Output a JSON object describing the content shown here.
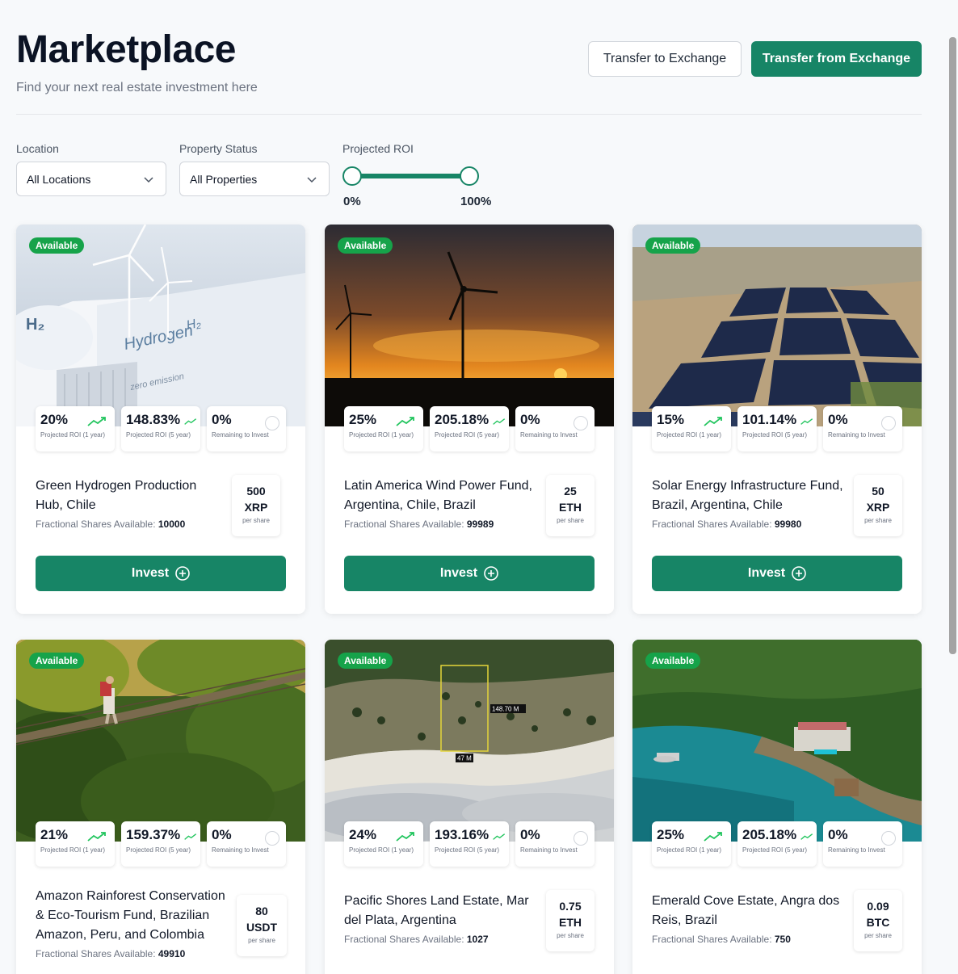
{
  "header": {
    "title": "Marketplace",
    "subtitle": "Find your next real estate investment here",
    "transfer_to": "Transfer to Exchange",
    "transfer_from": "Transfer from Exchange"
  },
  "filters": {
    "location_label": "Location",
    "location_value": "All Locations",
    "status_label": "Property Status",
    "status_value": "All Properties",
    "roi_label": "Projected ROI",
    "roi_min": "0%",
    "roi_max": "100%"
  },
  "labels": {
    "available": "Available",
    "roi_1y": "Projected ROI (1 year)",
    "roi_5y": "Projected ROI (5 year)",
    "remaining": "Remaining to Invest",
    "shares": "Fractional Shares Available:",
    "per_share": "per share",
    "invest": "Invest"
  },
  "colors": {
    "accent": "#178566",
    "badge": "#16a34a",
    "trend": "#22c55e"
  },
  "cards": [
    {
      "name": "Green Hydrogen Production Hub, Chile",
      "roi1": "20%",
      "roi5": "148.83%",
      "remaining": "0%",
      "shares": "10000",
      "price": "500",
      "currency": "XRP",
      "image": "hydrogen-plant-wind-turbines"
    },
    {
      "name": "Latin America Wind Power Fund, Argentina, Chile, Brazil",
      "roi1": "25%",
      "roi5": "205.18%",
      "remaining": "0%",
      "shares": "99989",
      "price": "25",
      "currency": "ETH",
      "image": "wind-turbines-sunset"
    },
    {
      "name": "Solar Energy Infrastructure Fund, Brazil, Argentina, Chile",
      "roi1": "15%",
      "roi5": "101.14%",
      "remaining": "0%",
      "shares": "99980",
      "price": "50",
      "currency": "XRP",
      "image": "solar-farm-aerial"
    },
    {
      "name": "Amazon Rainforest Conservation & Eco-Tourism Fund, Brazilian Amazon, Peru, and Colombia",
      "roi1": "21%",
      "roi5": "159.37%",
      "remaining": "0%",
      "shares": "49910",
      "price": "80",
      "currency": "USDT",
      "image": "rainforest-bridge"
    },
    {
      "name": "Pacific Shores Land Estate, Mar del Plata, Argentina",
      "roi1": "24%",
      "roi5": "193.16%",
      "remaining": "0%",
      "shares": "1027",
      "price": "0.75",
      "currency": "ETH",
      "image": "beach-land-plot-aerial",
      "plot_labels": [
        "148.70 M",
        "47 M"
      ]
    },
    {
      "name": "Emerald Cove Estate, Angra dos Reis, Brazil",
      "roi1": "25%",
      "roi5": "205.18%",
      "remaining": "0%",
      "shares": "750",
      "price": "0.09",
      "currency": "BTC",
      "image": "coastal-villa-aerial"
    }
  ]
}
